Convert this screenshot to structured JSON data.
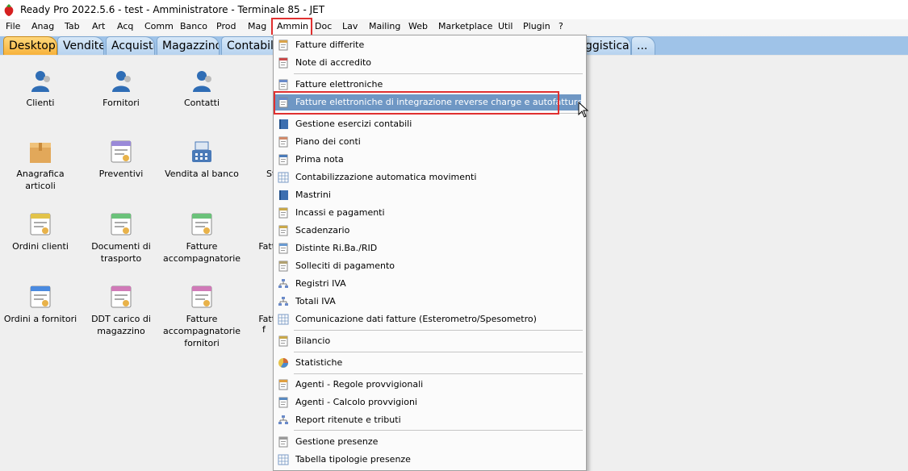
{
  "window": {
    "title": "Ready Pro 2022.5.6 - test - Amministratore - Terminale 85 - JET",
    "icon": "strawberry-icon"
  },
  "menubar": {
    "items": [
      "File",
      "Anag",
      "Tab",
      "Art",
      "Acq",
      "Comm",
      "Banco",
      "Prod",
      "Mag",
      "Ammin",
      "Doc",
      "Lav",
      "Mailing",
      "Web",
      "Marketplace",
      "Util",
      "Plugin",
      "?"
    ],
    "active": "Ammin"
  },
  "tabs": [
    "Desktop",
    "Vendite",
    "Acquisti",
    "Magazzino",
    "Contabili",
    "ggistica",
    "..."
  ],
  "desktop": {
    "icons": [
      {
        "label": "Clienti",
        "icon": "client-icon"
      },
      {
        "label": "Fornitori",
        "icon": "supplier-icon"
      },
      {
        "label": "Contatti",
        "icon": "contact-icon"
      },
      {
        "label": "Anagrafica articoli",
        "icon": "box-icon"
      },
      {
        "label": "Preventivi",
        "icon": "quote-icon"
      },
      {
        "label": "Vendita al banco",
        "icon": "register-icon"
      },
      {
        "label": "Sta",
        "icon": "partial-icon"
      },
      {
        "label": "Ordini clienti",
        "icon": "order-icon"
      },
      {
        "label": "Documenti di trasporto",
        "icon": "transport-doc-icon"
      },
      {
        "label": "Fatture accompagnatorie",
        "icon": "invoice-icon"
      },
      {
        "label": "Fattu",
        "icon": "invoice-icon"
      },
      {
        "label": "Ordini a fornitori",
        "icon": "order-icon"
      },
      {
        "label": "DDT carico di magazzino",
        "icon": "ddt-icon"
      },
      {
        "label": "Fatture accompagnatorie fornitori",
        "icon": "invoice-icon"
      },
      {
        "label": "Fattu",
        "icon": "invoice-icon"
      },
      {
        "label": "f",
        "icon": "invoice-icon"
      }
    ]
  },
  "dropdown": {
    "items": [
      {
        "label": "Fatture differite",
        "icon": "invoice-deferred-icon"
      },
      {
        "label": "Note di accredito",
        "icon": "credit-note-icon"
      },
      {
        "label": "Fatture elettroniche",
        "icon": "e-invoice-icon"
      },
      {
        "label": "Fatture elettroniche di integrazione reverse charge e autofatture",
        "icon": "e-invoice-icon"
      },
      {
        "label": "Gestione esercizi contabili",
        "icon": "ledger-icon"
      },
      {
        "label": "Piano dei conti",
        "icon": "chart-of-accounts-icon"
      },
      {
        "label": "Prima nota",
        "icon": "journal-icon"
      },
      {
        "label": "Contabilizzazione automatica movimenti",
        "icon": "grid-icon"
      },
      {
        "label": "Mastrini",
        "icon": "ledger-icon"
      },
      {
        "label": "Incassi e pagamenti",
        "icon": "payment-icon"
      },
      {
        "label": "Scadenzario",
        "icon": "schedule-icon"
      },
      {
        "label": "Distinte Ri.Ba./RID",
        "icon": "bank-icon"
      },
      {
        "label": "Solleciti di pagamento",
        "icon": "reminder-icon"
      },
      {
        "label": "Registri IVA",
        "icon": "tree-icon"
      },
      {
        "label": "Totali IVA",
        "icon": "tree-icon"
      },
      {
        "label": "Comunicazione dati fatture (Esterometro/Spesometro)",
        "icon": "grid-icon"
      },
      {
        "label": "Bilancio",
        "icon": "balance-icon"
      },
      {
        "label": "Statistiche",
        "icon": "pie-chart-icon"
      },
      {
        "label": "Agenti - Regole provvigionali",
        "icon": "agent-rules-icon"
      },
      {
        "label": "Agenti - Calcolo provvigioni",
        "icon": "agent-calc-icon"
      },
      {
        "label": "Report ritenute e tributi",
        "icon": "tree-icon"
      },
      {
        "label": "Gestione presenze",
        "icon": "attendance-icon"
      },
      {
        "label": "Tabella tipologie presenze",
        "icon": "grid-icon"
      }
    ],
    "highlighted": "Fatture elettroniche di integrazione reverse charge e autofatture"
  },
  "colors": {
    "highlight": "#6f97c4",
    "annotation": "#e03030",
    "active_tab": "#f7b23b",
    "tab": "#b7d3ef"
  }
}
